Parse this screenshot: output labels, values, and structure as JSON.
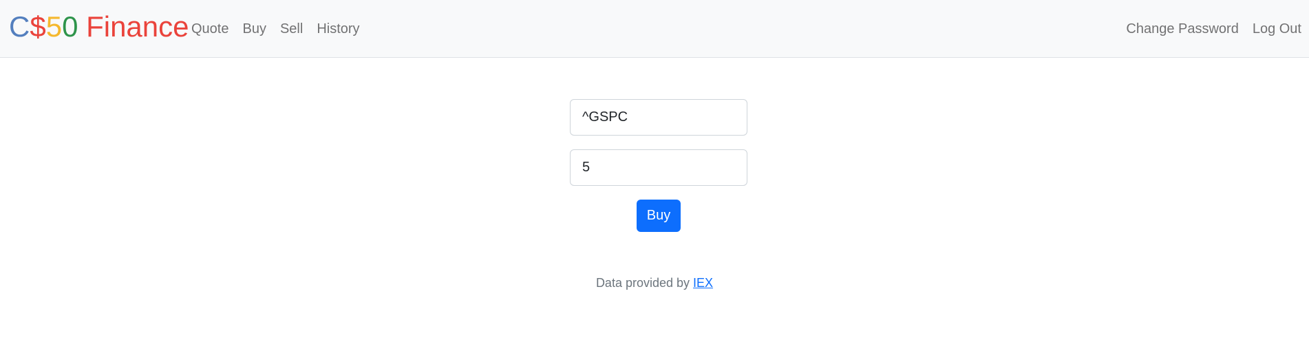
{
  "brand": {
    "parts": [
      {
        "text": "C",
        "color": "#537fbe"
      },
      {
        "text": "$",
        "color": "#ea433b"
      },
      {
        "text": "5",
        "color": "#f5b82e"
      },
      {
        "text": "0",
        "color": "#2e944b"
      },
      {
        "text": " Finance",
        "color": "#ea433b"
      }
    ]
  },
  "nav": {
    "left": [
      "Quote",
      "Buy",
      "Sell",
      "History"
    ],
    "right": [
      "Change Password",
      "Log Out"
    ]
  },
  "form": {
    "symbol_value": "^GSPC",
    "shares_value": "5",
    "submit_label": "Buy"
  },
  "footer": {
    "text": "Data provided by ",
    "link_label": "IEX"
  }
}
